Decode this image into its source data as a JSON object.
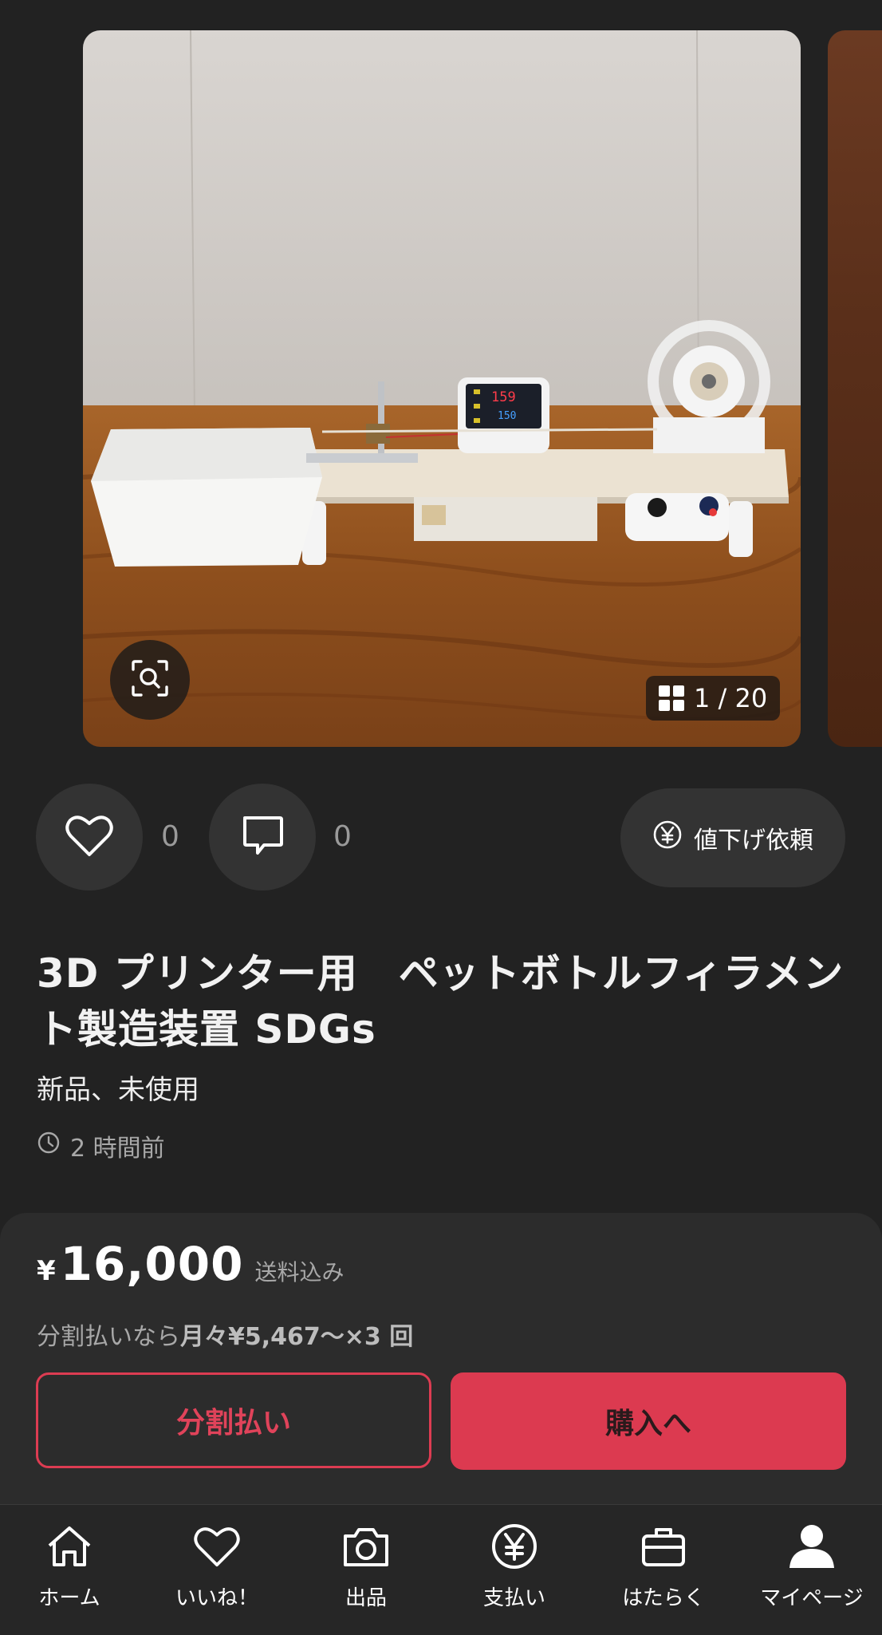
{
  "carousel": {
    "counter_text": "1 / 20"
  },
  "actions": {
    "like_count": "0",
    "comment_count": "0",
    "offer_label": "値下げ依頼"
  },
  "item": {
    "title": "3D プリンター用　ペットボトルフィラメント製造装置 SDGs",
    "condition": "新品、未使用",
    "posted": "2 時間前"
  },
  "purchase": {
    "currency_symbol": "¥",
    "price": "16,000",
    "shipping_note": "送料込み",
    "installment_prefix": "分割払いなら",
    "installment_detail": "月々¥5,467〜×3 回",
    "split_button": "分割払い",
    "buy_button": "購入へ"
  },
  "nav": {
    "items": [
      {
        "label": "ホーム",
        "icon": "home-icon"
      },
      {
        "label": "いいね！",
        "icon": "heart-icon"
      },
      {
        "label": "出品",
        "icon": "camera-icon"
      },
      {
        "label": "支払い",
        "icon": "yen-circle-icon"
      },
      {
        "label": "はたらく",
        "icon": "briefcase-icon"
      },
      {
        "label": "マイページ",
        "icon": "person-icon"
      }
    ]
  },
  "colors": {
    "background": "#222222",
    "accent": "#dc3a50",
    "panel": "#2c2c2c"
  }
}
